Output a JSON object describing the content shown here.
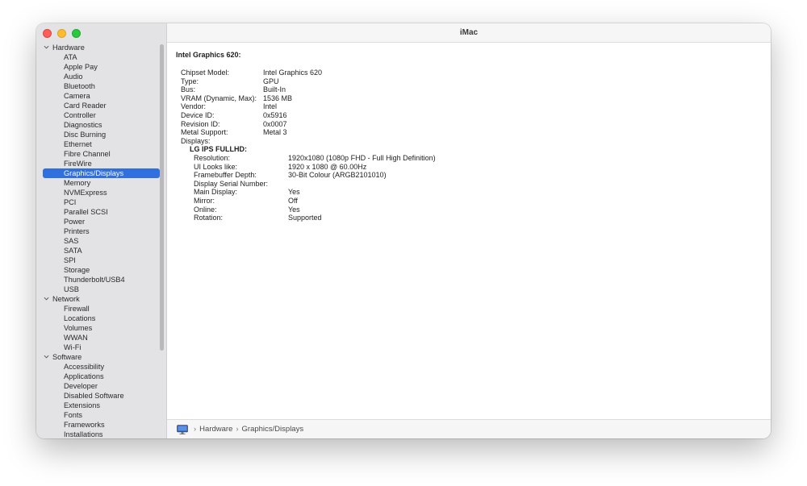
{
  "window": {
    "title": "iMac"
  },
  "sidebar": {
    "sections": [
      {
        "label": "Hardware",
        "items": [
          "ATA",
          "Apple Pay",
          "Audio",
          "Bluetooth",
          "Camera",
          "Card Reader",
          "Controller",
          "Diagnostics",
          "Disc Burning",
          "Ethernet",
          "Fibre Channel",
          "FireWire",
          "Graphics/Displays",
          "Memory",
          "NVMExpress",
          "PCI",
          "Parallel SCSI",
          "Power",
          "Printers",
          "SAS",
          "SATA",
          "SPI",
          "Storage",
          "Thunderbolt/USB4",
          "USB"
        ]
      },
      {
        "label": "Network",
        "items": [
          "Firewall",
          "Locations",
          "Volumes",
          "WWAN",
          "Wi-Fi"
        ]
      },
      {
        "label": "Software",
        "items": [
          "Accessibility",
          "Applications",
          "Developer",
          "Disabled Software",
          "Extensions",
          "Fonts",
          "Frameworks",
          "Installations"
        ]
      }
    ],
    "selected": "Graphics/Displays"
  },
  "details": {
    "heading": "Intel Graphics 620:",
    "rows": [
      {
        "key": "Chipset Model:",
        "value": "Intel Graphics 620"
      },
      {
        "key": "Type:",
        "value": "GPU"
      },
      {
        "key": "Bus:",
        "value": "Built-In"
      },
      {
        "key": "VRAM (Dynamic, Max):",
        "value": "1536 MB"
      },
      {
        "key": "Vendor:",
        "value": "Intel"
      },
      {
        "key": "Device ID:",
        "value": "0x5916"
      },
      {
        "key": "Revision ID:",
        "value": "0x0007"
      },
      {
        "key": "Metal Support:",
        "value": "Metal 3"
      },
      {
        "key": "Displays:",
        "value": ""
      }
    ],
    "display": {
      "name": "LG IPS FULLHD:",
      "rows": [
        {
          "key": "Resolution:",
          "value": "1920x1080 (1080p FHD - Full High Definition)"
        },
        {
          "key": "UI Looks like:",
          "value": "1920 x 1080 @ 60.00Hz"
        },
        {
          "key": "Framebuffer Depth:",
          "value": "30-Bit Colour (ARGB2101010)"
        },
        {
          "key": "Display Serial Number:",
          "value": ""
        },
        {
          "key": "Main Display:",
          "value": "Yes"
        },
        {
          "key": "Mirror:",
          "value": "Off"
        },
        {
          "key": "Online:",
          "value": "Yes"
        },
        {
          "key": "Rotation:",
          "value": "Supported"
        }
      ]
    }
  },
  "pathbar": {
    "icon": "imac-icon",
    "segments": [
      "Hardware",
      "Graphics/Displays"
    ]
  },
  "colors": {
    "selection": "#2f6fde",
    "close": "#ff5f57",
    "minimize": "#febc2e",
    "zoom": "#28c840"
  }
}
